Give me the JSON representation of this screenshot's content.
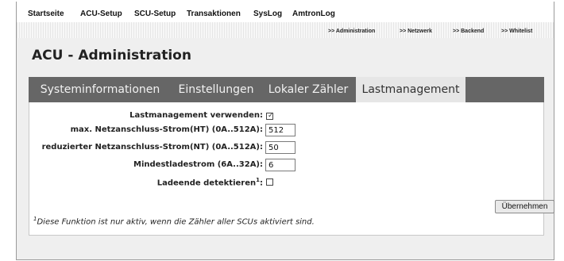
{
  "topnav": {
    "items": [
      "Startseite",
      "ACU-Setup",
      "SCU-Setup",
      "Transaktionen",
      "SysLog",
      "AmtronLog"
    ]
  },
  "subnav": {
    "items": [
      ">> Administration",
      ">> Netzwerk",
      ">> Backend",
      ">> Whitelist"
    ]
  },
  "page_title": "ACU - Administration",
  "tabs": [
    {
      "label": "Systeminformationen",
      "active": false
    },
    {
      "label": "Einstellungen",
      "active": false
    },
    {
      "label": "Lokaler Zähler",
      "active": false
    },
    {
      "label": "Lastmanagement",
      "active": true
    }
  ],
  "form": {
    "use_load_mgmt": {
      "label": "Lastmanagement verwenden:",
      "checked": true
    },
    "max_current_ht": {
      "label": "max. Netzanschluss-Strom(HT) (0A..512A):",
      "value": "512"
    },
    "reduced_current_nt": {
      "label": "reduzierter Netzanschluss-Strom(NT) (0A..512A):",
      "value": "50"
    },
    "min_charge_current": {
      "label": "Mindestladestrom (6A..32A):",
      "value": "6"
    },
    "detect_charge_end": {
      "label": "Ladeende detektieren",
      "sup": "1",
      "colon": ":",
      "checked": false
    }
  },
  "apply_button": "Übernehmen",
  "footnote": {
    "sup": "1",
    "text": "Diese Funktion ist nur aktiv, wenn die Zähler aller SCUs aktiviert sind."
  }
}
